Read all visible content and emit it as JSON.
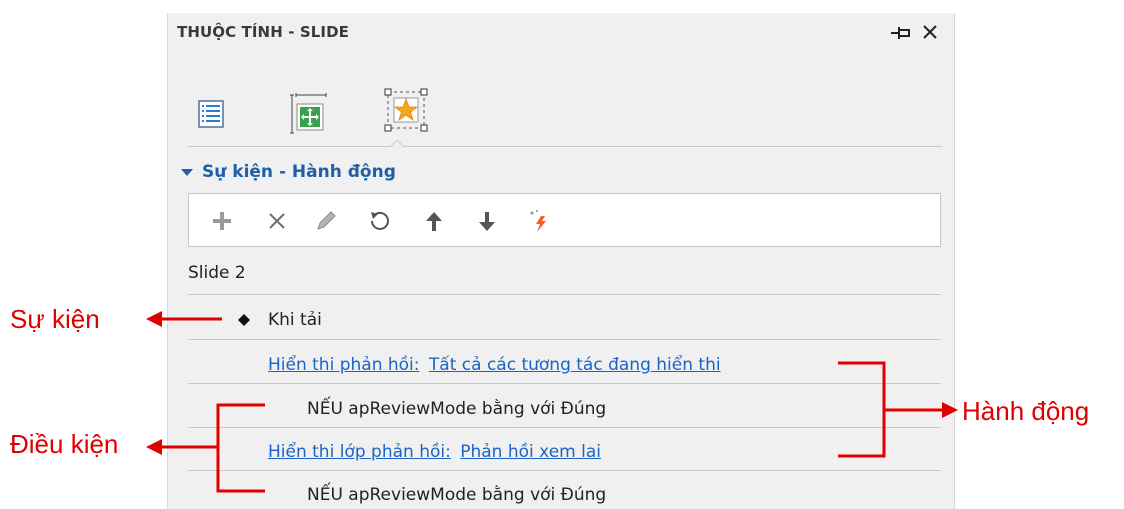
{
  "panel": {
    "title": "THUỘC TÍNH - SLIDE",
    "pin_icon": "pin-icon",
    "close_icon": "close-icon"
  },
  "tabs": [
    {
      "name": "properties",
      "icon": "list-icon"
    },
    {
      "name": "size-position",
      "icon": "move-icon"
    },
    {
      "name": "events-actions",
      "icon": "star-frame-icon",
      "selected": true
    }
  ],
  "section": {
    "title": "Sự kiện - Hành động",
    "expanded": true
  },
  "toolbar": {
    "buttons": [
      "add-icon",
      "delete-icon",
      "edit-icon",
      "undo-icon",
      "move-up-icon",
      "move-down-icon",
      "magic-icon"
    ]
  },
  "tree": {
    "slide_label": "Slide 2",
    "event_label": "Khi tải",
    "action1": {
      "label": "Hiển thi phản hồi:",
      "value": "Tất cả các tương tác đang hiển thi"
    },
    "condition1": "NẾU apReviewMode bằng với Đúng",
    "action2": {
      "label": "Hiển thi lớp phản hồi:",
      "value": "Phản hồi xem lai"
    },
    "condition2": "NẾU apReviewMode bằng với Đúng"
  },
  "annotations": {
    "event": "Sự kiện",
    "condition": "Điều kiện",
    "action": "Hành động"
  },
  "colors": {
    "panel_bg": "#f0f0f0",
    "link": "#1a64c8",
    "section_title": "#1f5fa7",
    "annotation": "#e00000"
  }
}
